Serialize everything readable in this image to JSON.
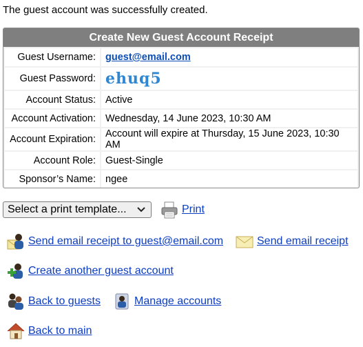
{
  "success_message": "The guest account was successfully created.",
  "receipt": {
    "title": "Create New Guest Account Receipt",
    "rows": [
      {
        "label": "Guest Username:",
        "value": "guest@email.com"
      },
      {
        "label": "Guest Password:",
        "value": "ehuq5"
      },
      {
        "label": "Account Status:",
        "value": "Active"
      },
      {
        "label": "Account Activation:",
        "value": "Wednesday, 14 June 2023, 10:30 AM"
      },
      {
        "label": "Account Expiration:",
        "value": "Account will expire at Thursday, 15 June 2023, 10:30 AM"
      },
      {
        "label": "Account Role:",
        "value": "Guest-Single"
      },
      {
        "label": "Sponsor’s Name:",
        "value": "ngee"
      }
    ]
  },
  "print_template": {
    "selected": "Select a print template..."
  },
  "actions": {
    "print": "Print",
    "send_receipt_to": "Send email receipt to guest@email.com",
    "send_receipt": "Send email receipt",
    "create_another": "Create another guest account",
    "back_to_guests": "Back to guests",
    "manage_accounts": "Manage accounts",
    "back_to_main": "Back to main"
  },
  "icons": {
    "printer": "printer-icon",
    "user_mail": "user-email-icon",
    "envelope": "envelope-icon",
    "user_add": "user-add-icon",
    "users_back": "users-icon",
    "user_manage": "user-manage-icon",
    "home": "home-icon",
    "dropdown": "chevron-down-icon"
  },
  "colors": {
    "link": "#0b3cc2",
    "header_bg": "#7f7f7f",
    "password": "#2f86d1"
  }
}
